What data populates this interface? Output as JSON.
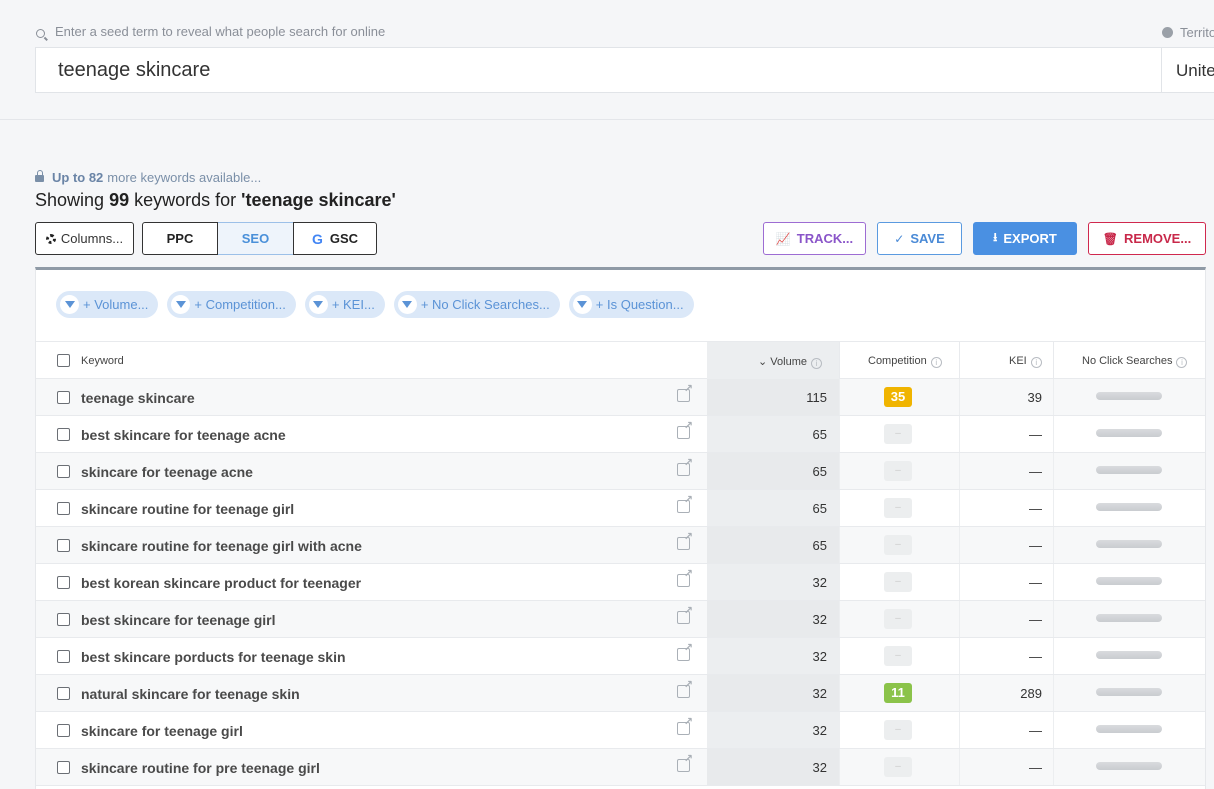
{
  "search": {
    "hint": "Enter a seed term to reveal what people search for online",
    "value": "teenage skincare",
    "territory_label": "Territory",
    "territory_value": "United States"
  },
  "summary": {
    "more_prefix": "Up to 82",
    "more_suffix": "more keywords available...",
    "showing_prefix": "Showing",
    "count": "99",
    "showing_middle": "keywords for",
    "query": "'teenage skincare'"
  },
  "toolbar": {
    "columns": "Columns...",
    "ppc": "PPC",
    "seo": "SEO",
    "gsc": "GSC",
    "track": "TRACK...",
    "save": "SAVE",
    "export": "EXPORT",
    "remove": "REMOVE..."
  },
  "filters": [
    "+ Volume...",
    "+ Competition...",
    "+ KEI...",
    "+ No Click Searches...",
    "+ Is Question..."
  ],
  "columns": {
    "keyword": "Keyword",
    "volume": "Volume",
    "competition": "Competition",
    "kei": "KEI",
    "no_click": "No Click Searches"
  },
  "colors": {
    "comp_high": "#f0b400",
    "comp_low": "#8bc34a",
    "export_bg": "#4a90e2"
  },
  "rows": [
    {
      "keyword": "teenage skincare",
      "volume": "115",
      "competition": "35",
      "comp_color": "#f0b400",
      "kei": "39"
    },
    {
      "keyword": "best skincare for teenage acne",
      "volume": "65",
      "competition": "–",
      "comp_color": "",
      "kei": "—"
    },
    {
      "keyword": "skincare for teenage acne",
      "volume": "65",
      "competition": "–",
      "comp_color": "",
      "kei": "—"
    },
    {
      "keyword": "skincare routine for teenage girl",
      "volume": "65",
      "competition": "–",
      "comp_color": "",
      "kei": "—"
    },
    {
      "keyword": "skincare routine for teenage girl with acne",
      "volume": "65",
      "competition": "–",
      "comp_color": "",
      "kei": "—"
    },
    {
      "keyword": "best korean skincare product for teenager",
      "volume": "32",
      "competition": "–",
      "comp_color": "",
      "kei": "—"
    },
    {
      "keyword": "best skincare for teenage girl",
      "volume": "32",
      "competition": "–",
      "comp_color": "",
      "kei": "—"
    },
    {
      "keyword": "best skincare porducts for teenage skin",
      "volume": "32",
      "competition": "–",
      "comp_color": "",
      "kei": "—"
    },
    {
      "keyword": "natural skincare for teenage skin",
      "volume": "32",
      "competition": "11",
      "comp_color": "#8bc34a",
      "kei": "289"
    },
    {
      "keyword": "skincare for teenage girl",
      "volume": "32",
      "competition": "–",
      "comp_color": "",
      "kei": "—"
    },
    {
      "keyword": "skincare routine for pre teenage girl",
      "volume": "32",
      "competition": "–",
      "comp_color": "",
      "kei": "—"
    }
  ]
}
